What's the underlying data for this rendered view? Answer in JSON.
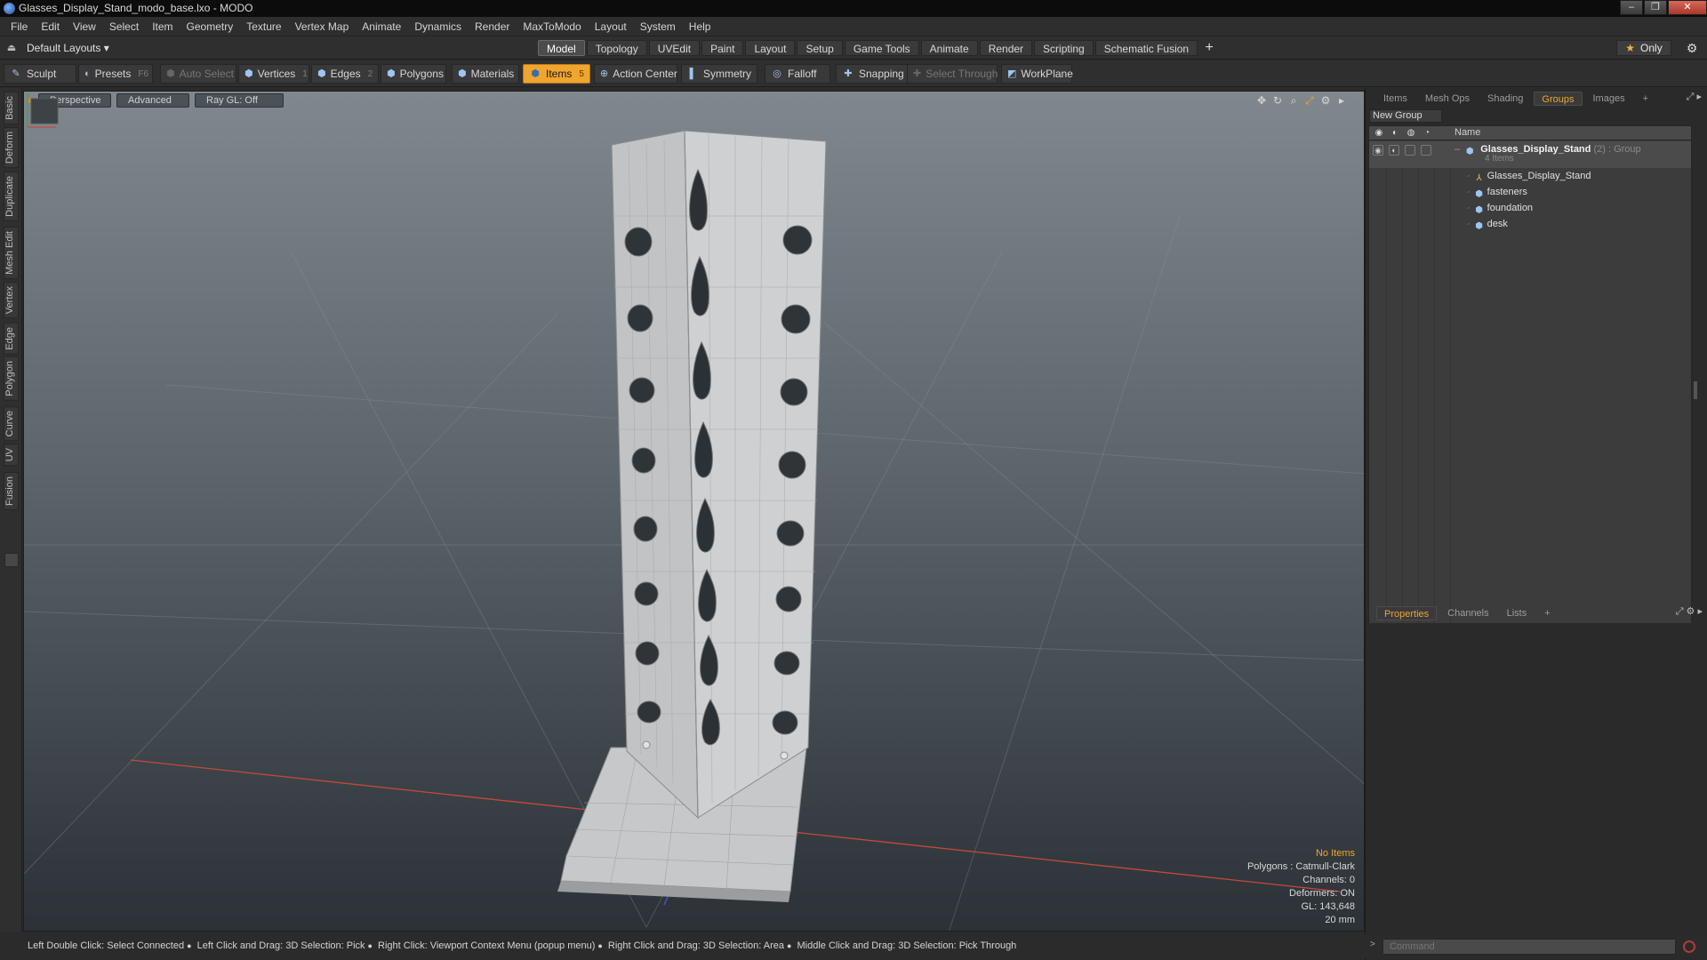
{
  "window": {
    "title": "Glasses_Display_Stand_modo_base.lxo - MODO"
  },
  "menu": [
    "File",
    "Edit",
    "View",
    "Select",
    "Item",
    "Geometry",
    "Texture",
    "Vertex Map",
    "Animate",
    "Dynamics",
    "Render",
    "MaxToModo",
    "Layout",
    "System",
    "Help"
  ],
  "layout": {
    "label": "Default Layouts ▾"
  },
  "mode_tabs": [
    {
      "label": "Model",
      "active": true
    },
    {
      "label": "Topology"
    },
    {
      "label": "UVEdit"
    },
    {
      "label": "Paint"
    },
    {
      "label": "Layout"
    },
    {
      "label": "Setup"
    },
    {
      "label": "Game Tools"
    },
    {
      "label": "Animate"
    },
    {
      "label": "Render"
    },
    {
      "label": "Scripting"
    },
    {
      "label": "Schematic Fusion"
    }
  ],
  "mode_add": "+",
  "only": {
    "star": "★",
    "label": "Only"
  },
  "toolbar": {
    "sculpt": "Sculpt",
    "presets": "Presets",
    "presets_key": "F6",
    "auto_select": "Auto Select",
    "vertices": "Vertices",
    "vertices_key": "1",
    "edges": "Edges",
    "edges_key": "2",
    "polygons": "Polygons",
    "materials": "Materials",
    "items": "Items",
    "items_key": "5",
    "action_center": "Action Center",
    "symmetry": "Symmetry",
    "falloff": "Falloff",
    "snapping": "Snapping",
    "select_through": "Select Through",
    "workplane": "WorkPlane"
  },
  "left_tabs": [
    "Basic",
    "Deform",
    "Duplicate",
    "Mesh Edit",
    "Vertex",
    "Edge",
    "Polygon",
    "Curve",
    "UV",
    "Fusion"
  ],
  "viewport": {
    "view": "Perspective",
    "shading": "Advanced",
    "raygl": "Ray GL: Off",
    "info": {
      "no_items": "No Items",
      "polygons": "Polygons : Catmull-Clark",
      "channels": "Channels: 0",
      "deformers": "Deformers: ON",
      "gl": "GL: 143,648",
      "scale": "20 mm"
    },
    "colors": {
      "background_top": "#7d858b",
      "background_bottom": "#2c3237",
      "model": "#c9c9c9",
      "accent": "#f0a52e"
    }
  },
  "status": [
    "Left Double Click: Select Connected",
    "Left Click and Drag: 3D Selection: Pick",
    "Right Click: Viewport Context Menu (popup menu)",
    "Right Click and Drag: 3D Selection: Area",
    "Middle Click and Drag: 3D Selection: Pick Through"
  ],
  "right_panel": {
    "tabs": [
      {
        "label": "Items"
      },
      {
        "label": "Mesh Ops"
      },
      {
        "label": "Shading"
      },
      {
        "label": "Groups",
        "active": true
      },
      {
        "label": "Images"
      },
      {
        "label": "+"
      }
    ],
    "new_group": "New Group",
    "column_name": "Name",
    "group": {
      "name": "Glasses_Display_Stand",
      "count": "(2)",
      "type": ": Group",
      "sub": "4 Items"
    },
    "items": [
      {
        "label": "Glasses_Display_Stand",
        "icon": "locator-icon"
      },
      {
        "label": "fasteners",
        "icon": "mesh-icon"
      },
      {
        "label": "foundation",
        "icon": "mesh-icon"
      },
      {
        "label": "desk",
        "icon": "mesh-icon"
      }
    ],
    "props_tabs": [
      {
        "label": "Properties",
        "active": true
      },
      {
        "label": "Channels"
      },
      {
        "label": "Lists"
      },
      {
        "label": "+"
      }
    ]
  },
  "command": {
    "placeholder": "Command"
  }
}
